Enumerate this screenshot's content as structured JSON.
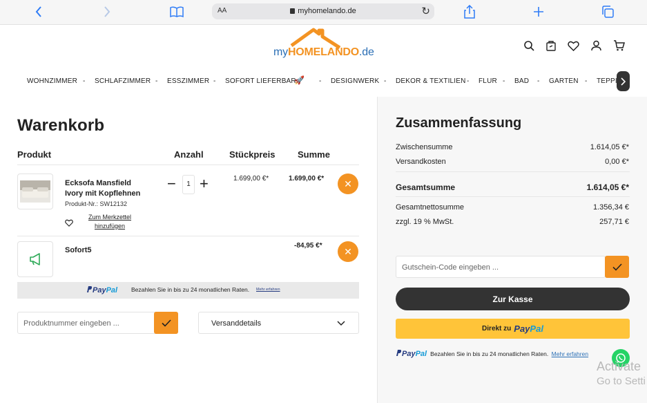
{
  "browser": {
    "url": "myhomelando.de",
    "text_size_label": "AA"
  },
  "logo": {
    "my": "my",
    "brand": "HOMELANDO",
    "tld": ".de"
  },
  "nav": {
    "items": [
      "WOHNZIMMER",
      "SCHLAFZIMMER",
      "ESSZIMMER",
      "SOFORT LIEFERBAR",
      "DESIGNWERK",
      "DEKOR & TEXTILIEN",
      "FLUR",
      "BAD",
      "GARTEN",
      "TEPPICH"
    ],
    "separator": "-",
    "rocket_icon": "🚀"
  },
  "cart": {
    "title": "Warenkorb",
    "headers": {
      "product": "Produkt",
      "qty": "Anzahl",
      "unit_price": "Stückpreis",
      "sum": "Summe"
    },
    "items": [
      {
        "name_line1": "Ecksofa Mansfield",
        "name_line2": "Ivory mit Kopflehnen",
        "sku": "Produkt-Nr.: SW12132",
        "qty": "1",
        "unit_price": "1.699,00 €*",
        "total": "1.699,00 €*",
        "wishlist_line1": "Zum Merkzettel",
        "wishlist_line2": "hinzufügen"
      },
      {
        "name": "Sofort5",
        "total": "-84,95 €*"
      }
    ],
    "paypal_banner": {
      "text": "Bezahlen Sie in bis zu 24 monatlichen Raten.",
      "link": "Mehr erfahren"
    },
    "product_number_placeholder": "Produktnummer eingeben ...",
    "shipping_details_label": "Versanddetails"
  },
  "summary": {
    "title": "Zusammenfassung",
    "subtotal_label": "Zwischensumme",
    "subtotal": "1.614,05 €*",
    "shipping_label": "Versandkosten",
    "shipping": "0,00 €*",
    "total_label": "Gesamtsumme",
    "total": "1.614,05 €*",
    "net_label": "Gesamtnettosumme",
    "net": "1.356,34 €",
    "vat_label": "zzgl. 19 % MwSt.",
    "vat": "257,71 €",
    "voucher_placeholder": "Gutschein-Code eingeben ...",
    "checkout_label": "Zur Kasse",
    "paypal_direct_prefix": "Direkt zu",
    "paypal_info": "Bezahlen Sie in bis zu 24 monatlichen Raten.",
    "paypal_info_link": "Mehr erfahren"
  },
  "paypal_logo": {
    "p1": "Pay",
    "p2": "Pal"
  },
  "os_watermark": {
    "line1": "Activate",
    "line2": "Go to Setti"
  },
  "colors": {
    "accent": "#f39323",
    "dark_button": "#333333",
    "paypal_yellow": "#ffc439",
    "paypal_blue": "#253b80"
  }
}
